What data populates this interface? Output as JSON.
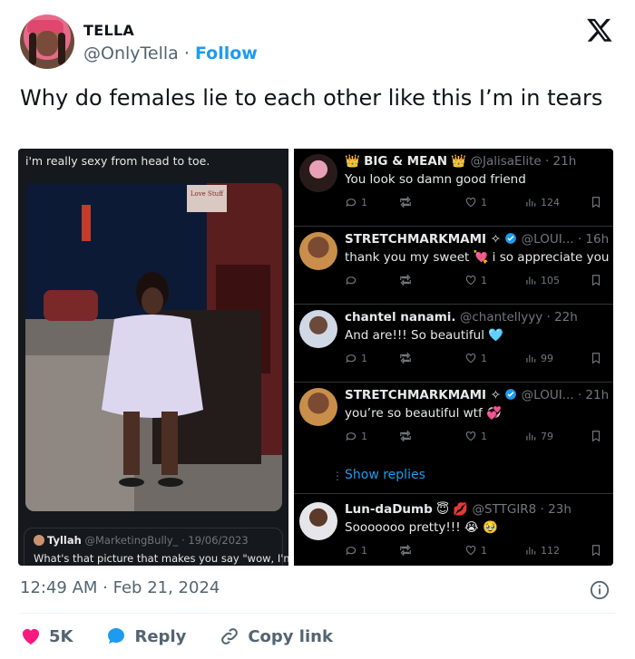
{
  "author": {
    "name": "TELLA",
    "handle": "@OnlyTella",
    "separator": "·",
    "follow_label": "Follow"
  },
  "tweet": {
    "text": "Why do females lie to each other like this I’m in tears",
    "timestamp": "12:49 AM · Feb 21, 2024"
  },
  "media": {
    "left": {
      "caption": "i'm really sexy from head to toe.",
      "sign_text": "Love Stuff",
      "quote": {
        "name": "Tyllah",
        "handle_date": "@MarketingBully_ · 19/06/2023",
        "text": "What's that picture that makes you say \"wow, I'm"
      }
    },
    "replies": [
      {
        "crown": "👑",
        "name": "BIG & MEAN",
        "crown_after": "👑",
        "meta": "@JalisaElite · 21h",
        "text": "You look so damn good friend",
        "replies": "1",
        "retweets": "",
        "likes": "1",
        "views": "124"
      },
      {
        "name": "STRETCHMARKMAMI ✧",
        "verified": true,
        "meta": "@LOUI... · 16h",
        "text": "thank you my sweet 💘 i so appreciate you",
        "replies": "",
        "retweets": "",
        "likes": "1",
        "views": "105"
      },
      {
        "name": "chantel nanami.",
        "meta": "@chantellyyy · 22h",
        "text": "And are!!! So beautiful 🩵",
        "replies": "1",
        "retweets": "",
        "likes": "1",
        "views": "99"
      },
      {
        "name": "STRETCHMARKMAMI ✧",
        "verified": true,
        "meta": "@LOUI... · 21h",
        "text": "you’re so beautiful wtf 💞",
        "replies": "1",
        "retweets": "",
        "likes": "1",
        "views": "79"
      },
      {
        "name": "Lun-daDumb",
        "badges": "😇 💋",
        "meta": "@STTGIR8 · 23h",
        "text": "Sooooooo pretty!!! 😭 🥹",
        "replies": "1",
        "retweets": "",
        "likes": "1",
        "views": "112"
      }
    ],
    "show_replies_label": "Show replies"
  },
  "footer": {
    "likes_count": "5K",
    "reply_label": "Reply",
    "copy_link_label": "Copy link"
  },
  "colors": {
    "accent": "#1d9bf0",
    "like": "#f91880",
    "muted": "#536471"
  }
}
